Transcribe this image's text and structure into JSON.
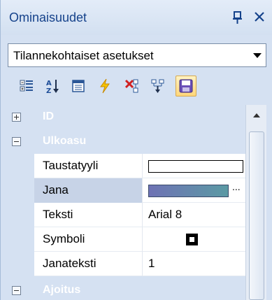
{
  "panel": {
    "title": "Ominaisuudet",
    "pin_icon": "pin-icon",
    "close_icon": "close-icon"
  },
  "selector": {
    "selected": "Tilannekohtaiset asetukset"
  },
  "toolbar": {
    "buttons": [
      {
        "icon": "categorized-icon"
      },
      {
        "icon": "alphabetical-sort-icon"
      },
      {
        "icon": "property-pages-icon"
      },
      {
        "icon": "events-icon"
      },
      {
        "icon": "disconnect-icon"
      },
      {
        "icon": "connect-icon"
      },
      {
        "icon": "save-icon",
        "active": true
      }
    ]
  },
  "grid": {
    "categories": [
      {
        "label": "ID",
        "expanded": false
      },
      {
        "label": "Ulkoasu",
        "expanded": true
      },
      {
        "label": "Ajoitus",
        "expanded": true
      }
    ],
    "rows": [
      {
        "name": "Taustatyyli",
        "value": ""
      },
      {
        "name": "Jana",
        "value": "...",
        "selected": true
      },
      {
        "name": "Teksti",
        "value": "Arial 8"
      },
      {
        "name": "Symboli",
        "value": ""
      },
      {
        "name": "Janateksti",
        "value": "1"
      }
    ]
  },
  "colors": {
    "title_text": "#15428b",
    "category_text": "#ffffff",
    "panel_bg": "#d5e1f2",
    "selected_row": "#c7d3e7"
  }
}
